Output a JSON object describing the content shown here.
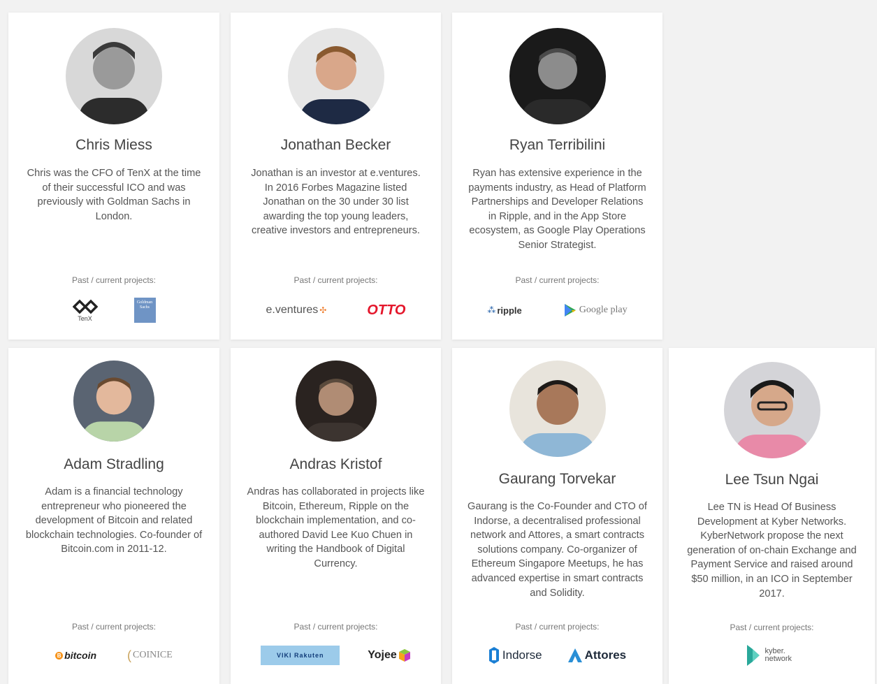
{
  "projects_label": "Past / current projects:",
  "members": [
    {
      "name": "Chris Miess",
      "bio": "Chris was the CFO of TenX at the time of their successful ICO and was previously with Goldman Sachs in London.",
      "logos": [
        {
          "label": "TenX",
          "icon": "tenx-logo-icon"
        },
        {
          "label": "Goldman Sachs",
          "icon": "goldman-sachs-logo-icon"
        }
      ]
    },
    {
      "name": "Jonathan Becker",
      "bio": "Jonathan is an investor at e.ventures. In 2016 Forbes Magazine listed Jonathan on the 30 under 30 list awarding the top young leaders, creative investors and entrepreneurs.",
      "logos": [
        {
          "label": "e.ventures",
          "icon": "eventures-logo-icon"
        },
        {
          "label": "OTTO",
          "icon": "otto-logo-icon"
        }
      ]
    },
    {
      "name": "Ryan Terribilini",
      "bio": "Ryan has extensive experience in the payments industry, as Head of Platform Partnerships and Developer Relations in Ripple, and in the App Store ecosystem, as Google Play Operations Senior Strategist.",
      "logos": [
        {
          "label": "ripple",
          "icon": "ripple-logo-icon"
        },
        {
          "label": "Google play",
          "icon": "google-play-logo-icon"
        }
      ]
    },
    {
      "name": "Adam Stradling",
      "bio": "Adam is a financial technology entrepreneur who pioneered the development of Bitcoin and related blockchain technologies. Co-founder of Bitcoin.com in 2011-12.",
      "logos": [
        {
          "label": "bitcoin",
          "icon": "bitcoin-logo-icon"
        },
        {
          "label": "COINICE",
          "icon": "coinice-logo-icon"
        }
      ]
    },
    {
      "name": "Andras Kristof",
      "bio": "Andras has collaborated in projects like Bitcoin, Ethereum, Ripple on the blockchain implementation, and co-authored David Lee Kuo Chuen in writing the Handbook of Digital Currency.",
      "logos": [
        {
          "label": "VIKI Rakuten",
          "icon": "viki-logo-icon"
        },
        {
          "label": "Yojee",
          "icon": "yojee-logo-icon"
        }
      ]
    },
    {
      "name": "Gaurang Torvekar",
      "bio": "Gaurang is the Co-Founder and CTO of Indorse, a decentralised professional network and Attores, a smart contracts solutions company. Co-organizer of Ethereum Singapore Meetups, he has advanced expertise in smart contracts and Solidity.",
      "logos": [
        {
          "label": "Indorse",
          "icon": "indorse-logo-icon"
        },
        {
          "label": "Attores",
          "icon": "attores-logo-icon"
        }
      ]
    },
    {
      "name": "Lee Tsun Ngai",
      "bio": "Lee TN is Head Of Business Development at Kyber Networks. KyberNetwork propose the next generation of on-chain Exchange and Payment Service and raised around $50 million, in an ICO in September 2017.",
      "logos": [
        {
          "label": "kyber. network",
          "icon": "kyber-network-logo-icon"
        }
      ]
    }
  ]
}
